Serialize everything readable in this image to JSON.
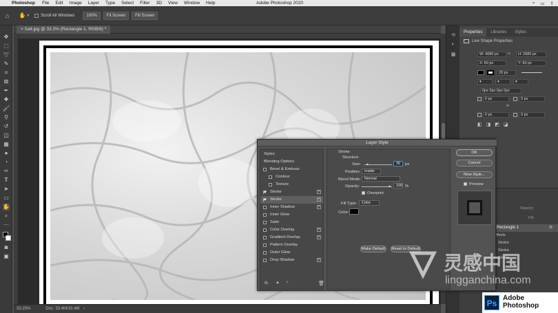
{
  "menubar": {
    "apple": "",
    "app": "Photoshop",
    "items": [
      "File",
      "Edit",
      "Image",
      "Layer",
      "Type",
      "Select",
      "Filter",
      "3D",
      "View",
      "Window",
      "Help"
    ],
    "title": "Adobe Photoshop 2020"
  },
  "options": {
    "scroll_all": "Scroll All Windows",
    "zoom": "100%",
    "fit": "Fit Screen",
    "fill": "Fill Screen"
  },
  "document": {
    "tab": "Salt.jpg @ 33.3% (Rectangle 1, RGB/8) *"
  },
  "status": {
    "zoom": "33.25%",
    "doc": "Doc: 33.4M/33.4M"
  },
  "properties": {
    "tabs": [
      "Properties",
      "Libraries",
      "Styles"
    ],
    "heading": "Live Shape Properties",
    "w": "W: 4080 px",
    "h": "H: 2680 px",
    "x": "X: 60 px",
    "y": "Y: 60 px",
    "stroke_width": "20 px",
    "radius_all": "0px 0px 0px 0px",
    "r1": "0 px",
    "r2": "0 px",
    "r3": "0 px",
    "r4": "0 px"
  },
  "layers": {
    "opacity_lbl": "Opacity:",
    "fill_lbl": "Fill:",
    "layer_name": "Rectangle 1",
    "effects": "Effects",
    "fx1": "Stroke",
    "fx2": "Stroke",
    "fx3": "Stroke"
  },
  "dialog": {
    "title": "Layer Style",
    "styles": [
      {
        "label": "Styles",
        "cb": "none",
        "plus": false
      },
      {
        "label": "Blending Options",
        "cb": "none",
        "plus": false
      },
      {
        "label": "Bevel & Emboss",
        "cb": "off",
        "plus": false
      },
      {
        "label": "Contour",
        "cb": "off",
        "plus": false,
        "indent": true
      },
      {
        "label": "Texture",
        "cb": "off",
        "plus": false,
        "indent": true
      },
      {
        "label": "Stroke",
        "cb": "on",
        "plus": true
      },
      {
        "label": "Stroke",
        "cb": "on",
        "plus": true,
        "sel": true
      },
      {
        "label": "Inner Shadow",
        "cb": "off",
        "plus": true
      },
      {
        "label": "Inner Glow",
        "cb": "off",
        "plus": false
      },
      {
        "label": "Satin",
        "cb": "off",
        "plus": false
      },
      {
        "label": "Color Overlay",
        "cb": "off",
        "plus": true
      },
      {
        "label": "Gradient Overlay",
        "cb": "off",
        "plus": true
      },
      {
        "label": "Pattern Overlay",
        "cb": "off",
        "plus": false
      },
      {
        "label": "Outer Glow",
        "cb": "off",
        "plus": false
      },
      {
        "label": "Drop Shadow",
        "cb": "off",
        "plus": true
      }
    ],
    "section": "Stroke",
    "structure": "Structure",
    "size_lbl": "Size:",
    "size_val": "30",
    "size_unit": "px",
    "position_lbl": "Position:",
    "position_val": "Inside",
    "blend_lbl": "Blend Mode:",
    "blend_val": "Normal",
    "opacity_lbl": "Opacity:",
    "opacity_val": "100",
    "opacity_unit": "%",
    "overprint": "Overprint",
    "filltype_lbl": "Fill Type:",
    "filltype_val": "Color",
    "color_lbl": "Color:",
    "make_default": "Make Default",
    "reset_default": "Reset to Default",
    "ok": "OK",
    "cancel": "Cancel",
    "new_style": "New Style...",
    "preview": "Preview",
    "fx": "fx."
  },
  "watermark": {
    "cn": "灵感中国",
    "url": "lingganchina.com"
  },
  "badge": {
    "ps": "Ps",
    "adobe": "Adobe",
    "photoshop": "Photoshop"
  }
}
